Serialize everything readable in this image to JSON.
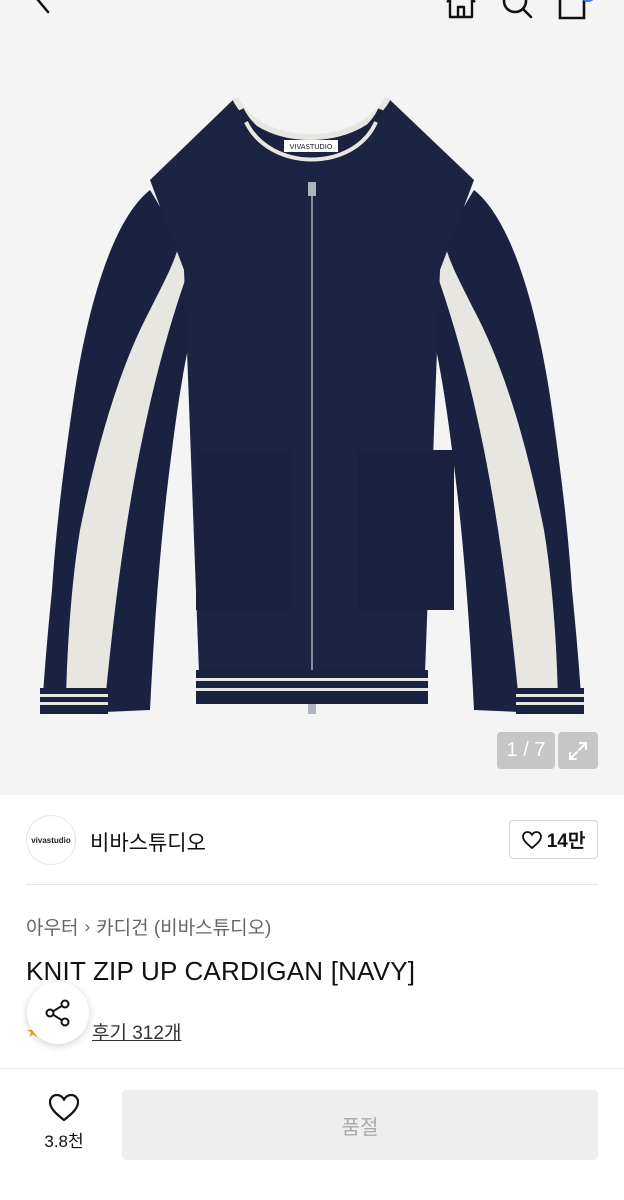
{
  "header": {
    "back_icon": "chevron-left-icon",
    "home_icon": "home-icon",
    "search_icon": "search-icon",
    "cart_icon": "cart-icon"
  },
  "gallery": {
    "pager_text": "1 / 7",
    "product_label": "VIVASTUDIO",
    "colors": {
      "background": "#f4f4f4",
      "knit_navy": "#1b2140",
      "knit_cream": "#e8e6e0"
    }
  },
  "brand": {
    "logo_text": "vivastudio",
    "name": "비바스튜디오",
    "like_count": "14만"
  },
  "product": {
    "breadcrumb": [
      "아우터",
      "카디건 (비바스튜디오)"
    ],
    "title": "KNIT ZIP UP CARDIGAN [NAVY]",
    "review_link": "후기 312개"
  },
  "footer": {
    "wish_count": "3.8천",
    "buy_label": "품절"
  }
}
